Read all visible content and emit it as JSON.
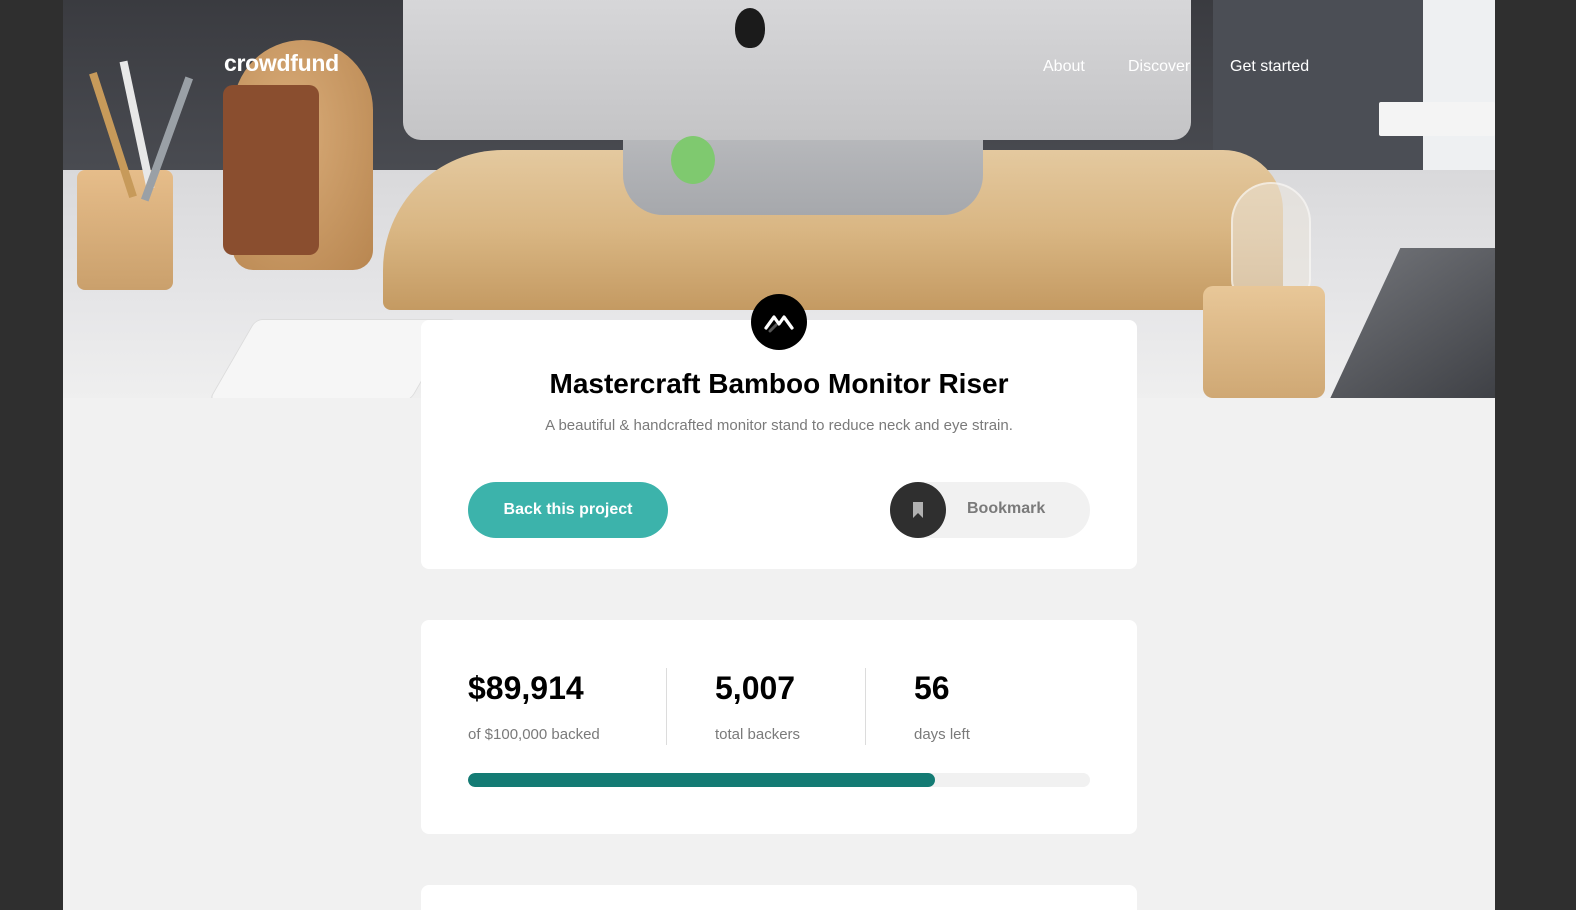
{
  "header": {
    "logo": "crowdfund",
    "nav": [
      "About",
      "Discover",
      "Get started"
    ]
  },
  "project": {
    "logo_icon": "mastercraft-logo-icon",
    "title": "Mastercraft Bamboo Monitor Riser",
    "subtitle": "A beautiful & handcrafted monitor stand to reduce neck and eye strain.",
    "back_button": "Back this project",
    "bookmark_label": "Bookmark",
    "bookmark_icon": "bookmark-icon"
  },
  "stats": {
    "backed_amount": "$89,914",
    "backed_label": "of $100,000 backed",
    "backers": "5,007",
    "backers_label": "total backers",
    "days": "56",
    "days_label": "days left",
    "progress_fraction": 0.75
  },
  "colors": {
    "accent": "#3cb3ab",
    "accent_dark": "#147b74",
    "page_bg": "#f1f1f1",
    "outer_bg": "#2f2f2f"
  }
}
